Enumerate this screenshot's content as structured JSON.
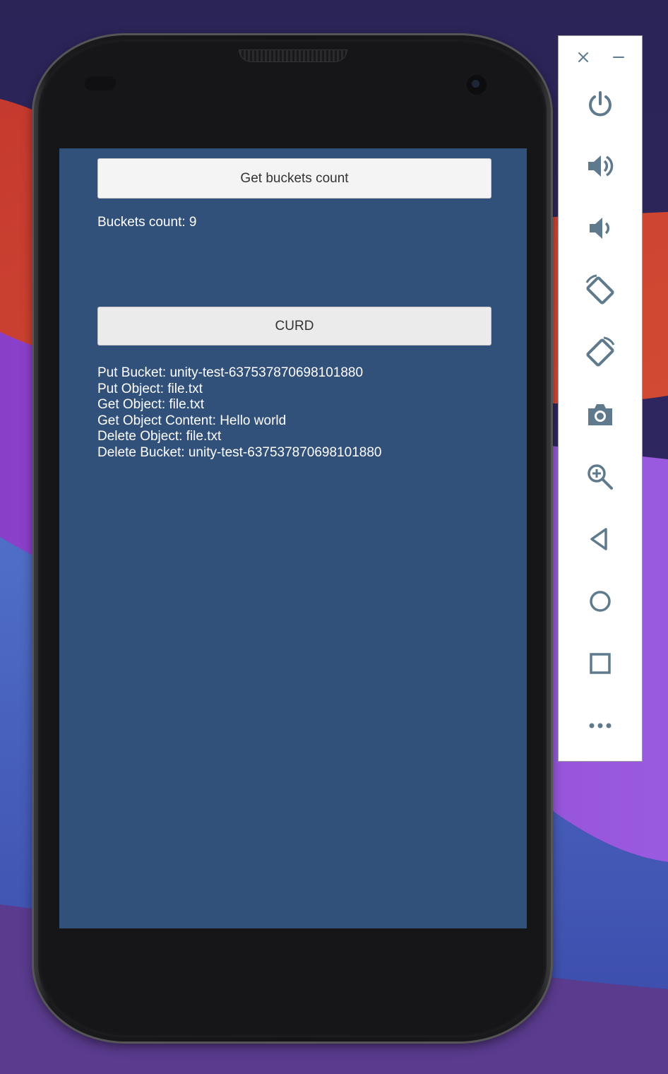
{
  "app": {
    "get_count_button": "Get buckets count",
    "count_result": "Buckets count: 9",
    "curd_button": "CURD",
    "curd_log": [
      "Put Bucket: unity-test-637537870698101880",
      "Put Object: file.txt",
      "Get Object: file.txt",
      "Get Object Content: Hello world",
      "Delete Object: file.txt",
      "Delete Bucket: unity-test-637537870698101880"
    ]
  },
  "emulator_toolbar": {
    "window_controls": [
      "close-icon",
      "minimize-icon"
    ],
    "buttons": [
      "power-icon",
      "volume-up-icon",
      "volume-down-icon",
      "rotate-left-icon",
      "rotate-right-icon",
      "camera-icon",
      "zoom-icon",
      "back-icon",
      "home-icon",
      "overview-icon",
      "more-icon"
    ],
    "icon_color": "#5f7a8c"
  },
  "colors": {
    "screen_background": "#31507a",
    "button_background": "#f4f4f4",
    "text": "#ffffff"
  }
}
